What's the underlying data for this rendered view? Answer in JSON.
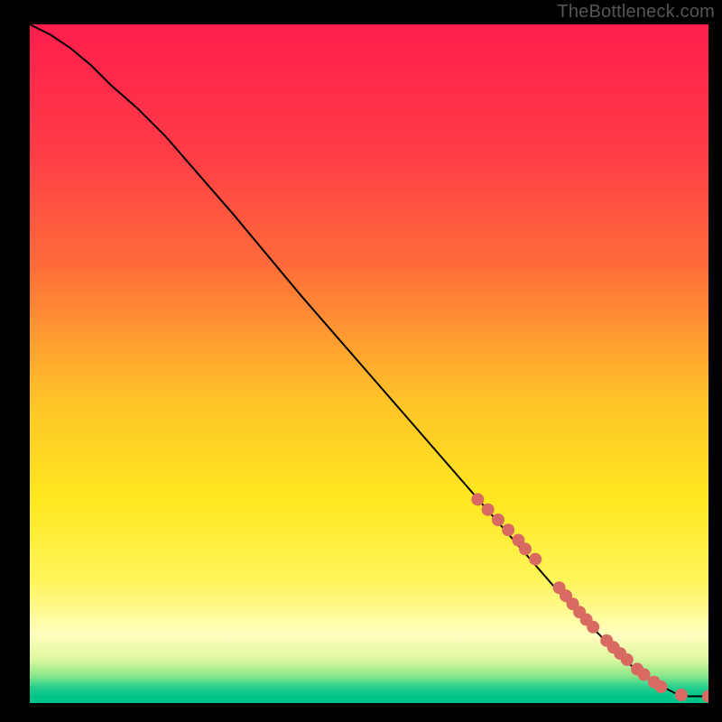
{
  "watermark": "TheBottleneck.com",
  "chart_data": {
    "type": "line",
    "title": "",
    "xlabel": "",
    "ylabel": "",
    "xlim": [
      0,
      100
    ],
    "ylim": [
      0,
      100
    ],
    "background_gradient_stops": [
      {
        "pct": 0,
        "color": "#ff1e4c"
      },
      {
        "pct": 18,
        "color": "#ff3a47"
      },
      {
        "pct": 35,
        "color": "#ff6a3a"
      },
      {
        "pct": 55,
        "color": "#ffc229"
      },
      {
        "pct": 70,
        "color": "#ffe81f"
      },
      {
        "pct": 82,
        "color": "#fff55a"
      },
      {
        "pct": 90,
        "color": "#fffec0"
      },
      {
        "pct": 93.5,
        "color": "#def7a0"
      },
      {
        "pct": 96,
        "color": "#8be68a"
      },
      {
        "pct": 97.5,
        "color": "#2ed18f"
      },
      {
        "pct": 99,
        "color": "#00c389"
      },
      {
        "pct": 100,
        "color": "#00c389"
      }
    ],
    "series": [
      {
        "name": "curve",
        "color": "#000000",
        "x": [
          0,
          3,
          6,
          9,
          12,
          16,
          20,
          30,
          40,
          50,
          60,
          70,
          80,
          88,
          92,
          95,
          97,
          100
        ],
        "y": [
          100,
          98.5,
          96.5,
          94,
          91,
          87.5,
          83.5,
          72,
          60,
          48.5,
          37,
          25.5,
          14,
          6,
          3,
          1.5,
          1,
          1
        ]
      }
    ],
    "scatter": {
      "name": "dots",
      "color": "#d96a62",
      "radius_px": 7,
      "points_xy": [
        [
          66,
          30
        ],
        [
          67.5,
          28.5
        ],
        [
          69,
          27
        ],
        [
          70.5,
          25.5
        ],
        [
          72,
          24
        ],
        [
          73,
          22.7
        ],
        [
          74.5,
          21.2
        ],
        [
          78,
          17
        ],
        [
          79,
          15.8
        ],
        [
          80,
          14.6
        ],
        [
          81,
          13.4
        ],
        [
          82,
          12.3
        ],
        [
          83,
          11.2
        ],
        [
          85,
          9.2
        ],
        [
          86,
          8.2
        ],
        [
          87,
          7.3
        ],
        [
          88,
          6.4
        ],
        [
          89.5,
          5
        ],
        [
          90.5,
          4.2
        ],
        [
          92,
          3.1
        ],
        [
          93,
          2.4
        ],
        [
          96,
          1.2
        ],
        [
          100,
          1
        ]
      ]
    }
  }
}
